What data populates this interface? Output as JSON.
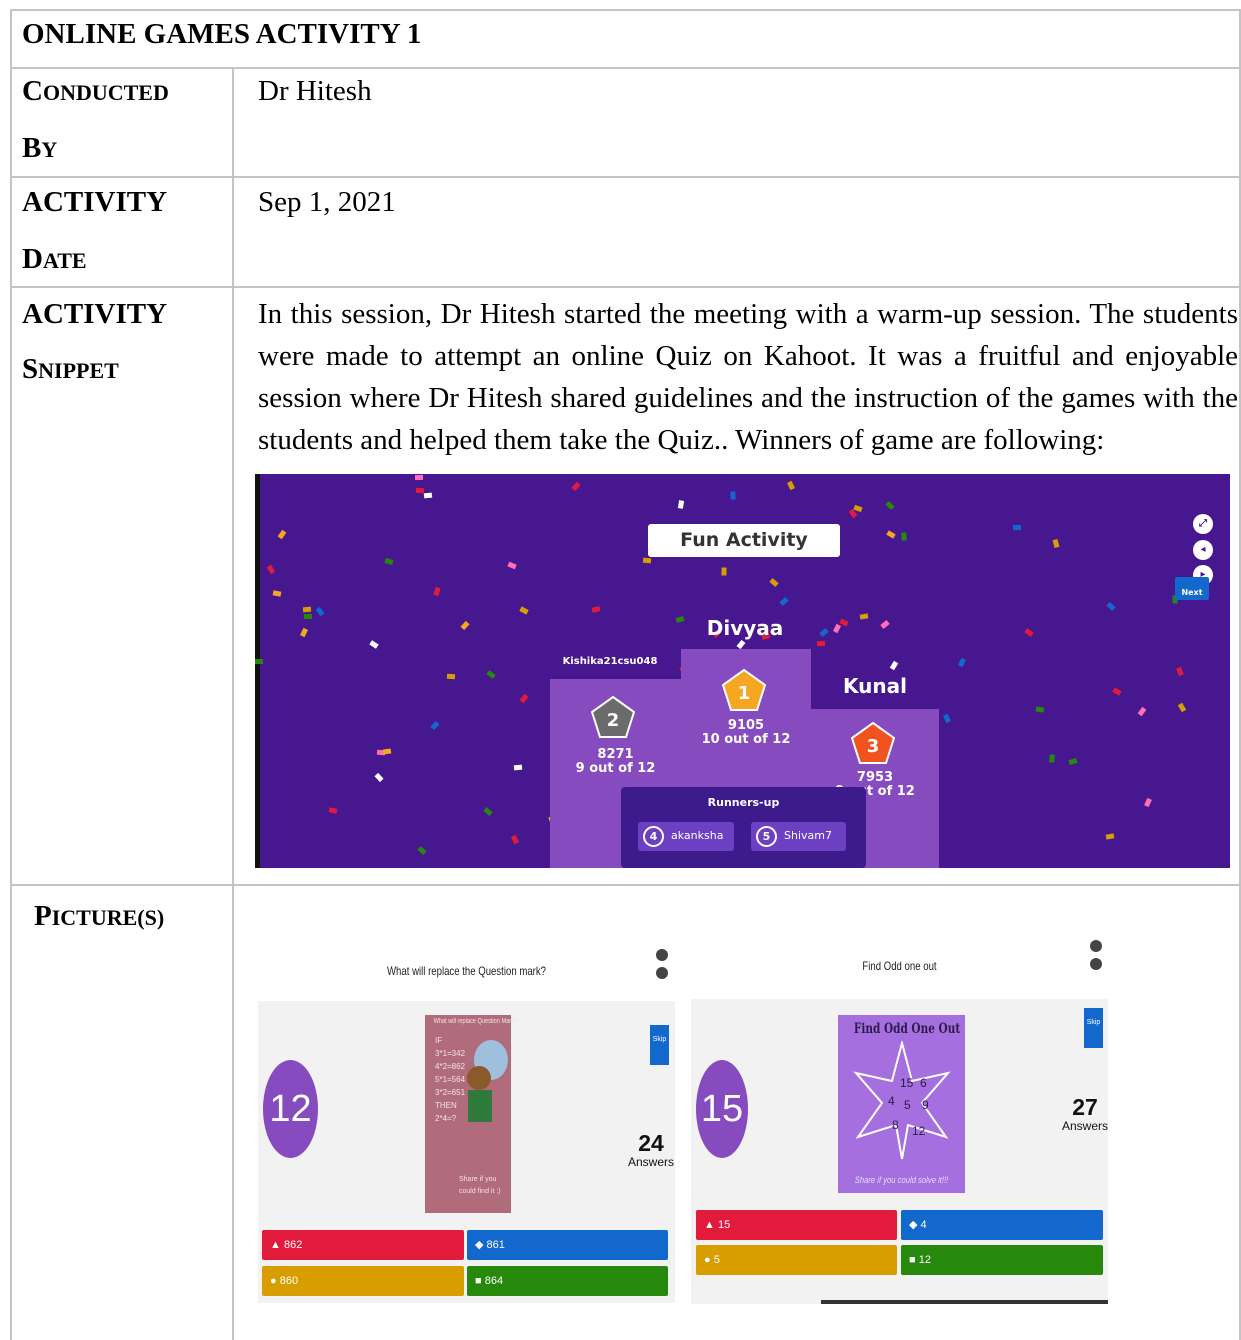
{
  "header": {
    "title": "ONLINE GAMES ACTIVITY 1"
  },
  "rows": {
    "conducted": {
      "label_1": "C",
      "label_2": "ONDUCTED",
      "label_3": "B",
      "label_4": "Y",
      "value": "Dr Hitesh"
    },
    "date": {
      "label_1": "ACTIVITY",
      "label_2": "D",
      "label_3": "ATE",
      "value": "Sep 1, 2021"
    },
    "snippet": {
      "label_1": "ACTIVITY",
      "label_2": "S",
      "label_3": "NIPPET",
      "value": "In this session, Dr Hitesh started the meeting with a warm-up session. The students were made to attempt an online Quiz on Kahoot. It was a fruitful and enjoyable session where Dr Hitesh shared guidelines and the instruction of the games with the students and helped them take the Quiz.. Winners of game are following:"
    },
    "pictures": {
      "label_1": "P",
      "label_2": "ICTURE",
      "label_3": "(S)"
    }
  },
  "kahoot": {
    "title": "Fun Activity",
    "next_label": "Next",
    "first": {
      "name": "Divyaa",
      "rank": "1",
      "score": "9105",
      "correct": "10 out of 12"
    },
    "second": {
      "name": "Kishika21csu048",
      "rank": "2",
      "score": "8271",
      "correct": "9 out of 12"
    },
    "third": {
      "name": "Kunal",
      "rank": "3",
      "score": "7953",
      "correct": "9 out of 12"
    },
    "runners_label": "Runners-up",
    "runners": [
      {
        "rank": "4",
        "name": "akanksha"
      },
      {
        "rank": "5",
        "name": "Shivam7"
      }
    ],
    "colors": {
      "bg": "#46178f",
      "podium": "#864cbf",
      "gold": "#f5a623",
      "silver": "#6b6b6b",
      "bronze": "#f0531e"
    }
  },
  "quiz1": {
    "question": "What will replace the Question mark?",
    "timer": "12",
    "answers_count": "24",
    "answers_label": "Answers",
    "skip": "Skip",
    "image_lines": [
      "What will replace Question Mark?",
      "IF",
      "3*1=342",
      "4*2=862",
      "5*1=564",
      "3*2=651",
      "THEN",
      "2*4=?",
      "Share if you",
      "could find it :)"
    ],
    "options": [
      "862",
      "861",
      "860",
      "864"
    ]
  },
  "quiz2": {
    "question": "Find Odd one out",
    "timer": "15",
    "answers_count": "27",
    "answers_label": "Answers",
    "skip": "Skip",
    "image_title": "Find Odd One Out",
    "image_numbers": [
      "15",
      "6",
      "4",
      "5",
      "9",
      "8",
      "12"
    ],
    "image_footer": "Share if you could solve it!!!",
    "options": [
      "15",
      "4",
      "5",
      "12"
    ]
  },
  "answer_colors": {
    "red": "#e21b3c",
    "blue": "#1368ce",
    "yellow": "#d89e00",
    "green": "#26890c"
  }
}
